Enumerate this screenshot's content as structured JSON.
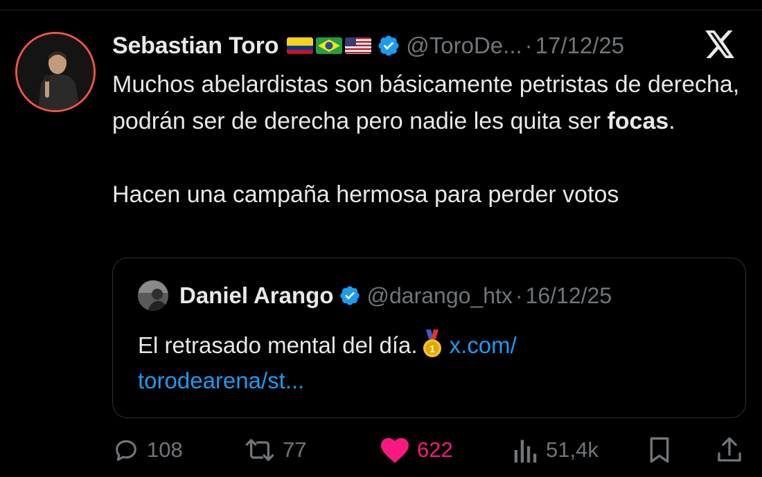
{
  "tweet": {
    "author": "Sebastian Toro",
    "handle": "@ToroDe...",
    "separator": "·",
    "date": "17/12/25",
    "text_line1": "Muchos abelardistas son básicamente petristas de derecha, podrán ser de derecha pero nadie les quita ser ",
    "text_bold": "focas",
    "text_after_bold": ".",
    "text_para2": "Hacen una campaña hermosa para perder votos",
    "flags": [
      "colombia-flag",
      "brazil-flag",
      "usa-flag"
    ],
    "icons": {
      "verified": "verified-badge-icon",
      "platform": "x-logo-icon"
    }
  },
  "quoted": {
    "author": "Daniel Arango",
    "handle": "@darango_htx",
    "separator": "·",
    "date": "16/12/25",
    "text": "El retrasado mental del día.",
    "emoji": "medal-icon",
    "link_part1": "x.com/",
    "link_part2": "torodearena/st..."
  },
  "actions": {
    "replies": "108",
    "retweets": "77",
    "likes": "622",
    "views": "51,4k"
  },
  "colors": {
    "background": "#000000",
    "text": "#e7e9ea",
    "muted": "#71767b",
    "link": "#1d9bf0",
    "like": "#f91880",
    "verified": "#1d9bf0",
    "avatar_ring": "#f2553e"
  }
}
